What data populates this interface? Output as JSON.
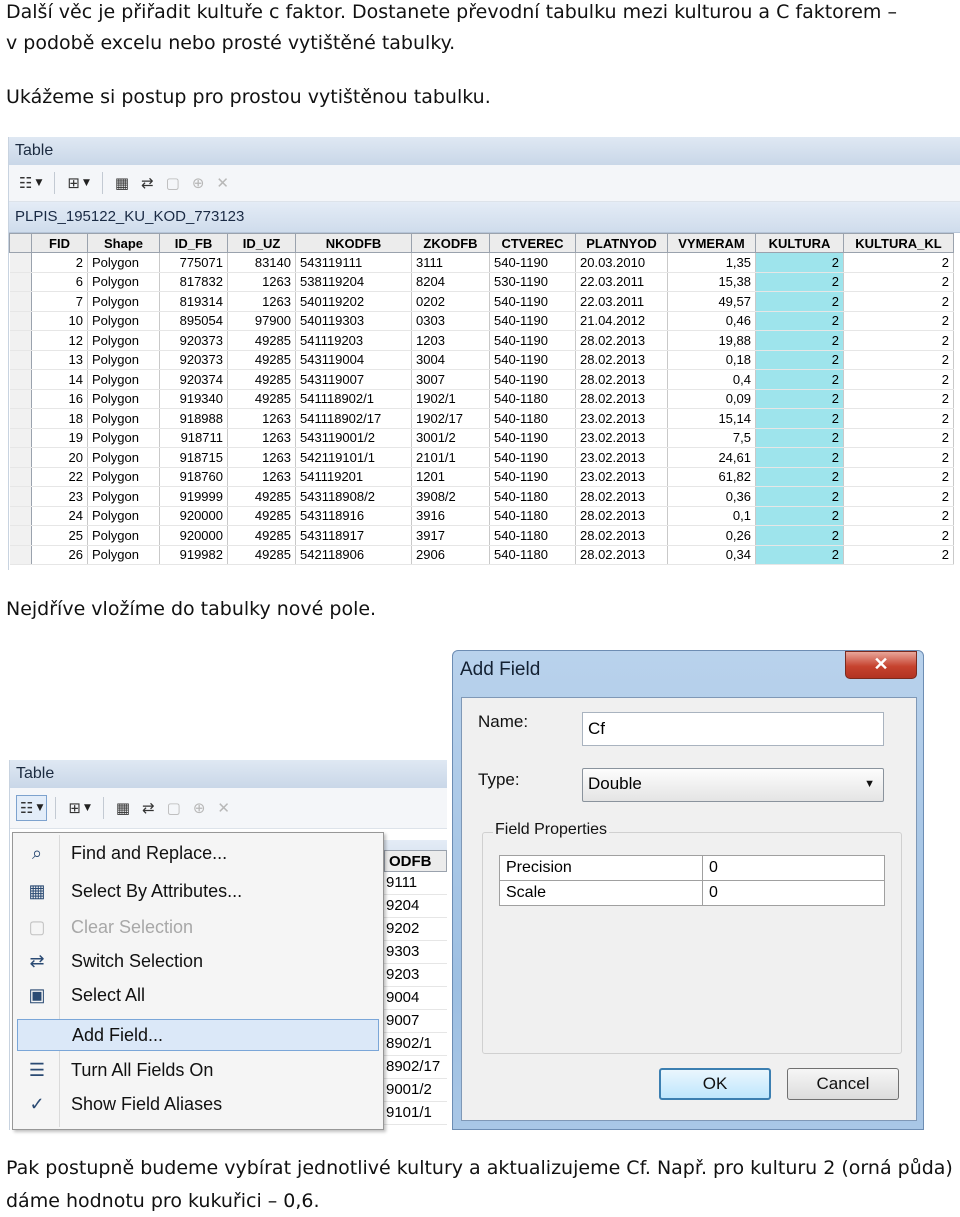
{
  "text": {
    "p1_line1": "Další věc je přiřadit kultuře c faktor. Dostanete převodní tabulku mezi kulturou a C faktorem –",
    "p1_line2": "v podobě excelu nebo prosté vytištěné tabulky.",
    "p2": "Ukážeme si postup pro prostou vytištěnou tabulku.",
    "p3": "Nejdříve vložíme do tabulky nové pole.",
    "p4_line1": "Pak postupně budeme vybírat jednotlivé kultury a aktualizujeme Cf. Např. pro kulturu 2 (orná půda)",
    "p4_line2": "dáme hodnotu pro kukuřici – 0,6."
  },
  "table_window": {
    "title": "Table",
    "table_name": "PLPIS_195122_KU_KOD_773123",
    "columns": [
      "FID",
      "Shape",
      "ID_FB",
      "ID_UZ",
      "NKODFB",
      "ZKODFB",
      "CTVEREC",
      "PLATNYOD",
      "VYMERAM",
      "KULTURA",
      "KULTURA_KL"
    ],
    "highlight_color": "#9ee4ec",
    "rows": [
      [
        "2",
        "Polygon",
        "775071",
        "83140",
        "543119111",
        "3111",
        "540-1190",
        "20.03.2010",
        "1,35",
        "2",
        "2"
      ],
      [
        "6",
        "Polygon",
        "817832",
        "1263",
        "538119204",
        "8204",
        "530-1190",
        "22.03.2011",
        "15,38",
        "2",
        "2"
      ],
      [
        "7",
        "Polygon",
        "819314",
        "1263",
        "540119202",
        "0202",
        "540-1190",
        "22.03.2011",
        "49,57",
        "2",
        "2"
      ],
      [
        "10",
        "Polygon",
        "895054",
        "97900",
        "540119303",
        "0303",
        "540-1190",
        "21.04.2012",
        "0,46",
        "2",
        "2"
      ],
      [
        "12",
        "Polygon",
        "920373",
        "49285",
        "541119203",
        "1203",
        "540-1190",
        "28.02.2013",
        "19,88",
        "2",
        "2"
      ],
      [
        "13",
        "Polygon",
        "920373",
        "49285",
        "543119004",
        "3004",
        "540-1190",
        "28.02.2013",
        "0,18",
        "2",
        "2"
      ],
      [
        "14",
        "Polygon",
        "920374",
        "49285",
        "543119007",
        "3007",
        "540-1190",
        "28.02.2013",
        "0,4",
        "2",
        "2"
      ],
      [
        "16",
        "Polygon",
        "919340",
        "49285",
        "541118902/1",
        "1902/1",
        "540-1180",
        "28.02.2013",
        "0,09",
        "2",
        "2"
      ],
      [
        "18",
        "Polygon",
        "918988",
        "1263",
        "541118902/17",
        "1902/17",
        "540-1180",
        "23.02.2013",
        "15,14",
        "2",
        "2"
      ],
      [
        "19",
        "Polygon",
        "918711",
        "1263",
        "543119001/2",
        "3001/2",
        "540-1190",
        "23.02.2013",
        "7,5",
        "2",
        "2"
      ],
      [
        "20",
        "Polygon",
        "918715",
        "1263",
        "542119101/1",
        "2101/1",
        "540-1190",
        "23.02.2013",
        "24,61",
        "2",
        "2"
      ],
      [
        "22",
        "Polygon",
        "918760",
        "1263",
        "541119201",
        "1201",
        "540-1190",
        "23.02.2013",
        "61,82",
        "2",
        "2"
      ],
      [
        "23",
        "Polygon",
        "919999",
        "49285",
        "543118908/2",
        "3908/2",
        "540-1180",
        "28.02.2013",
        "0,36",
        "2",
        "2"
      ],
      [
        "24",
        "Polygon",
        "920000",
        "49285",
        "543118916",
        "3916",
        "540-1180",
        "28.02.2013",
        "0,1",
        "2",
        "2"
      ],
      [
        "25",
        "Polygon",
        "920000",
        "49285",
        "543118917",
        "3917",
        "540-1180",
        "28.02.2013",
        "0,26",
        "2",
        "2"
      ],
      [
        "26",
        "Polygon",
        "919982",
        "49285",
        "542118906",
        "2906",
        "540-1180",
        "28.02.2013",
        "0,34",
        "2",
        "2"
      ]
    ]
  },
  "table_window2": {
    "title": "Table",
    "partial_header": "ODFB",
    "partial_cells": [
      "9111",
      "9204",
      "9202",
      "9303",
      "9203",
      "9004",
      "9007",
      "8902/1",
      "8902/17",
      "9001/2",
      "9101/1"
    ]
  },
  "menu": {
    "items": [
      {
        "label": "Find and Replace...",
        "icon": "binoculars-icon",
        "glyph": "⌕"
      },
      {
        "label": "Select By Attributes...",
        "icon": "select-by-attributes-icon",
        "glyph": "▦"
      },
      {
        "label": "Clear Selection",
        "icon": "clear-selection-icon",
        "glyph": "▢"
      },
      {
        "label": "Switch Selection",
        "icon": "switch-selection-icon",
        "glyph": "⇄"
      },
      {
        "label": "Select All",
        "icon": "select-all-icon",
        "glyph": "▣"
      },
      {
        "label": "Add Field...",
        "icon": "",
        "glyph": ""
      },
      {
        "label": "Turn All Fields On",
        "icon": "fields-list-icon",
        "glyph": "☰"
      },
      {
        "label": "Show Field Aliases",
        "icon": "checkmark-icon",
        "glyph": "✓"
      }
    ]
  },
  "dialog": {
    "title": "Add Field",
    "close_glyph": "✕",
    "name_label": "Name:",
    "name_value": "Cf",
    "type_label": "Type:",
    "type_value": "Double",
    "group_label": "Field Properties",
    "properties": [
      {
        "name": "Precision",
        "value": "0"
      },
      {
        "name": "Scale",
        "value": "0"
      }
    ],
    "ok_label": "OK",
    "cancel_label": "Cancel"
  }
}
